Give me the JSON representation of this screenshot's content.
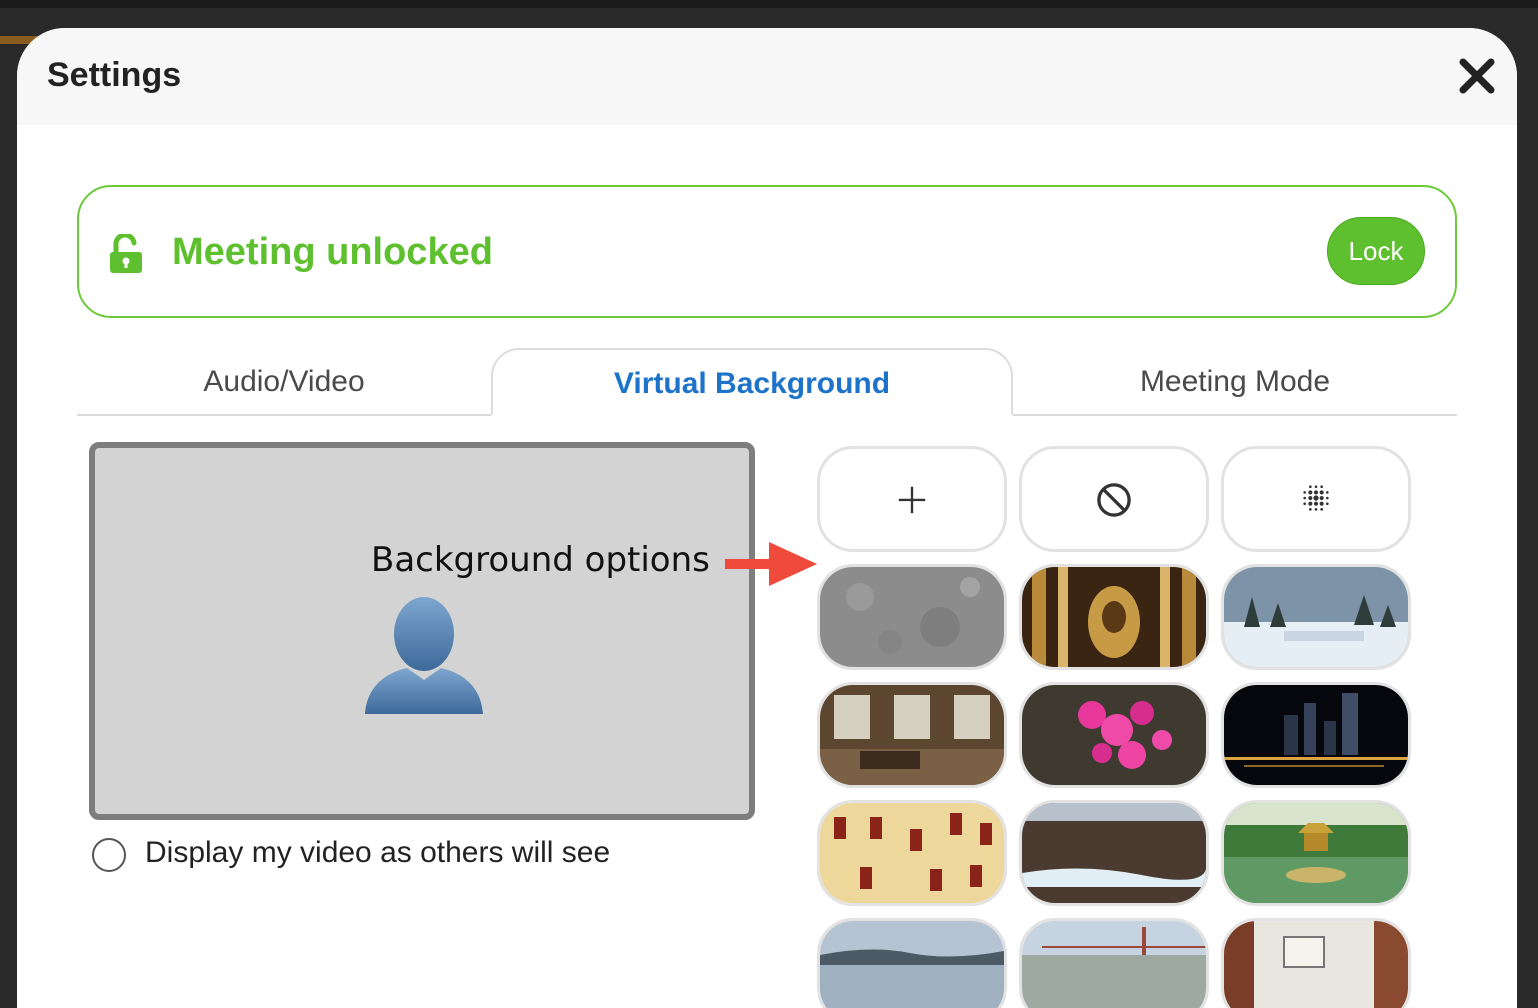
{
  "settings": {
    "title": "Settings",
    "close_icon": "close-icon"
  },
  "lock": {
    "status": "Meeting unlocked",
    "button_label": "Lock",
    "icon": "unlocked-padlock-icon",
    "color": "#5ec02e"
  },
  "tabs": [
    {
      "label": "Audio/Video",
      "active": false
    },
    {
      "label": "Virtual Background",
      "active": true
    },
    {
      "label": "Meeting Mode",
      "active": false
    }
  ],
  "preview": {
    "annotation": "Background options",
    "avatar_icon": "person-silhouette-icon",
    "arrow_icon": "red-arrow-icon"
  },
  "display_option": {
    "label": "Display my video as others will see",
    "checked": false
  },
  "background_options": [
    "add-background-icon",
    "no-background-icon",
    "blur-background-icon"
  ],
  "background_images": [
    "stone-texture",
    "ornate-hall",
    "snowy-landscape",
    "living-room",
    "pink-flowers",
    "city-night",
    "building-facade",
    "glacier",
    "pagoda-garden",
    "lake-mountains",
    "harbor-bridge",
    "library-room"
  ],
  "colors": {
    "accent_green": "#5ec02e",
    "tab_active_blue": "#1d73c9"
  }
}
